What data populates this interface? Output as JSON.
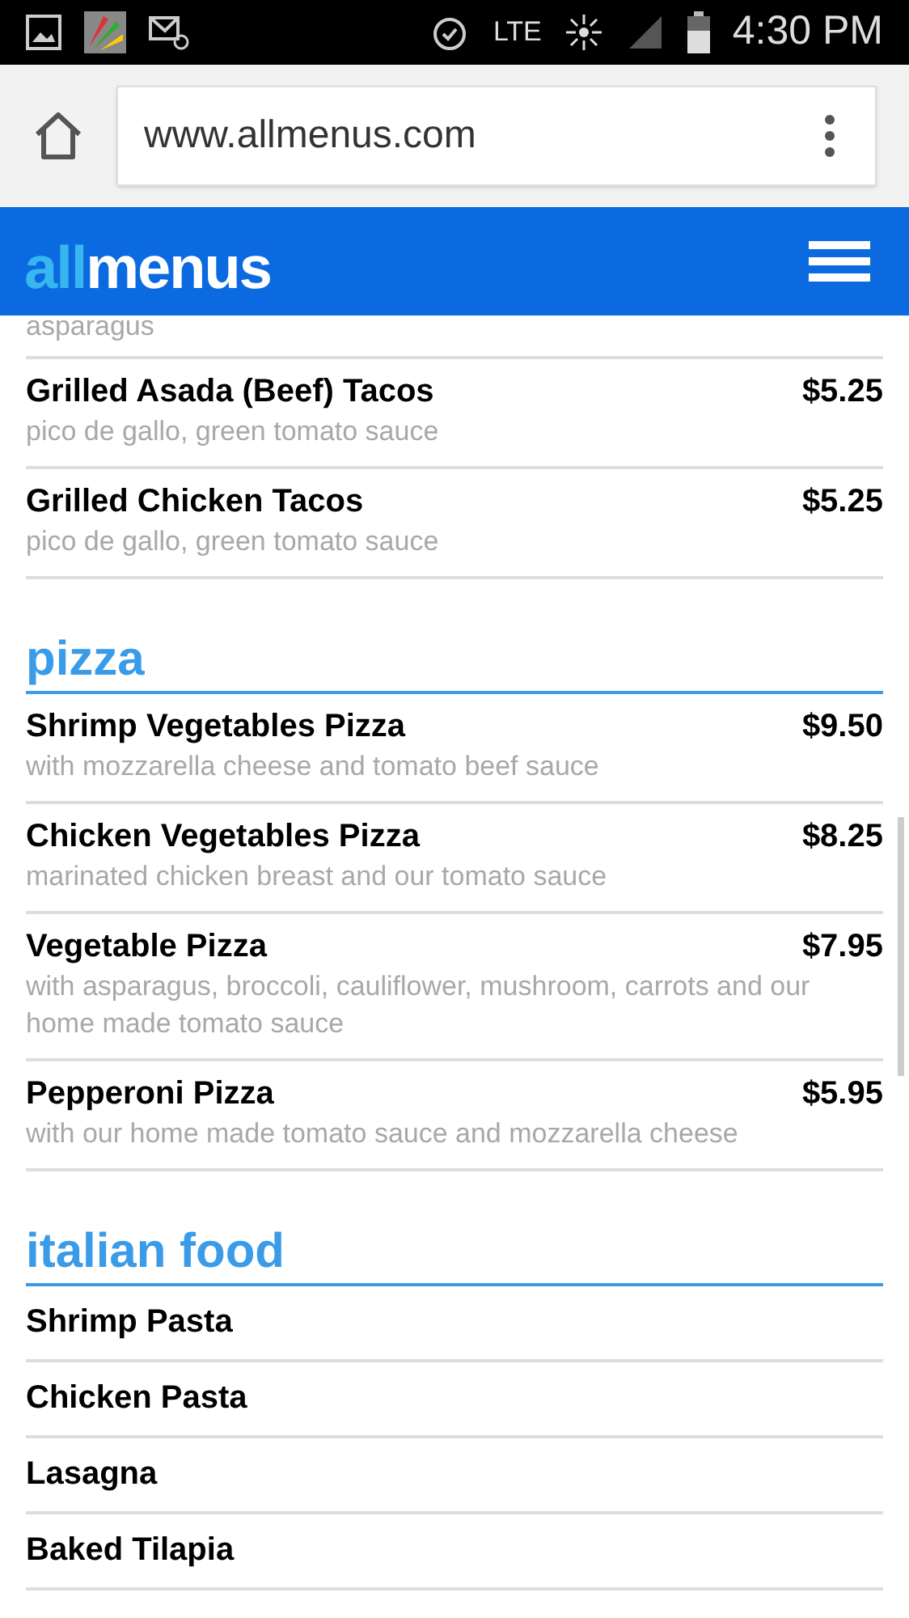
{
  "status_bar": {
    "time": "4:30 PM",
    "network": "LTE"
  },
  "browser": {
    "url": "www.allmenus.com"
  },
  "header": {
    "logo_accent": "all",
    "logo_rest": "menus"
  },
  "cut_off_text": "asparagus",
  "sections": [
    {
      "items": [
        {
          "name": "Grilled Asada (Beef) Tacos",
          "price": "$5.25",
          "description": "pico de gallo, green tomato sauce"
        },
        {
          "name": "Grilled Chicken Tacos",
          "price": "$5.25",
          "description": "pico de gallo, green tomato sauce"
        }
      ]
    },
    {
      "title": "pizza",
      "items": [
        {
          "name": "Shrimp Vegetables Pizza",
          "price": "$9.50",
          "description": "with mozzarella cheese and tomato beef sauce"
        },
        {
          "name": "Chicken Vegetables Pizza",
          "price": "$8.25",
          "description": "marinated chicken breast and our tomato sauce"
        },
        {
          "name": "Vegetable Pizza",
          "price": "$7.95",
          "description": "with asparagus, broccoli, cauliflower, mushroom, carrots and our home made tomato sauce"
        },
        {
          "name": "Pepperoni Pizza",
          "price": "$5.95",
          "description": "with our home made tomato sauce and mozzarella cheese"
        }
      ]
    },
    {
      "title": "italian food",
      "items": [
        {
          "name": "Shrimp Pasta"
        },
        {
          "name": "Chicken Pasta"
        },
        {
          "name": "Lasagna"
        },
        {
          "name": "Baked Tilapia"
        }
      ]
    }
  ]
}
